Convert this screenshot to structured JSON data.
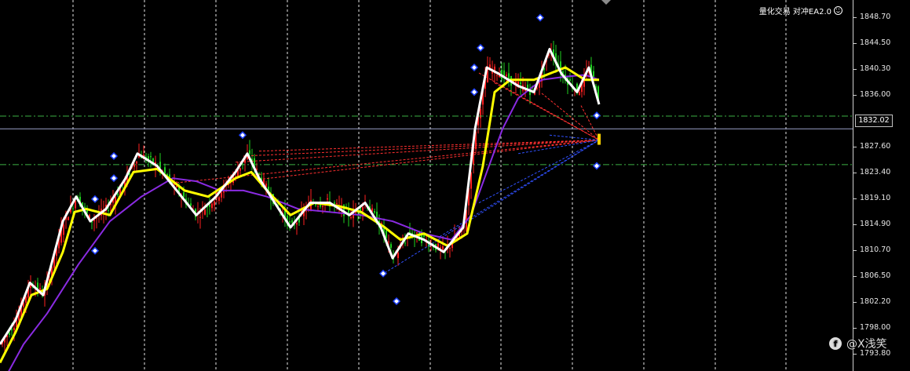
{
  "indicator": {
    "label": "量化交易 对冲EA2.0",
    "icon": "smiley-icon"
  },
  "price_axis": {
    "ticks": [
      "1848.70",
      "1844.50",
      "1840.30",
      "1836.00",
      "1827.60",
      "1823.40",
      "1819.10",
      "1814.90",
      "1810.70",
      "1806.50",
      "1802.20",
      "1798.00",
      "1793.80"
    ],
    "current_price": "1832.02"
  },
  "watermark": {
    "logo_text": "f",
    "text": "@X浅笑"
  },
  "colors": {
    "background": "#000000",
    "grid": "#ffffff",
    "bull_candle": "#ff2020",
    "bear_candle": "#20d020",
    "ma_fast": "#ffffff",
    "ma_mid": "#ffff00",
    "ma_slow": "#8a2be2",
    "level_line": "#3cb043",
    "price_line": "#9aa0c8",
    "projection_red": "#ff3030",
    "projection_blue": "#3050ff",
    "signal_marker": "#1e40ff"
  },
  "chart_data": {
    "type": "candlestick",
    "symbol_hint": "XAUUSD",
    "ylim": [
      1793.8,
      1850.5
    ],
    "level_lines": [
      1834.1,
      1826.2
    ],
    "current_price": 1832.02,
    "anchor": {
      "x": 763,
      "price": 1830.2
    },
    "close_path": [
      [
        0,
        1797
      ],
      [
        20,
        1801
      ],
      [
        40,
        1806.5
      ],
      [
        60,
        1805.5
      ],
      [
        80,
        1816
      ],
      [
        95,
        1820
      ],
      [
        110,
        1818
      ],
      [
        135,
        1819
      ],
      [
        165,
        1826
      ],
      [
        200,
        1825
      ],
      [
        230,
        1823
      ],
      [
        260,
        1820
      ],
      [
        290,
        1822
      ],
      [
        310,
        1827
      ],
      [
        335,
        1823
      ],
      [
        360,
        1816
      ],
      [
        390,
        1820
      ],
      [
        420,
        1820
      ],
      [
        450,
        1818
      ],
      [
        470,
        1819
      ],
      [
        495,
        1813
      ],
      [
        520,
        1816
      ],
      [
        545,
        1813
      ],
      [
        575,
        1812.5
      ],
      [
        595,
        1818
      ],
      [
        615,
        1838
      ],
      [
        630,
        1841
      ],
      [
        660,
        1840
      ],
      [
        690,
        1842
      ],
      [
        710,
        1844
      ],
      [
        730,
        1840
      ],
      [
        750,
        1841
      ],
      [
        763,
        1838
      ]
    ],
    "ma_fast": [
      [
        0,
        1797
      ],
      [
        20,
        1801
      ],
      [
        40,
        1806.5
      ],
      [
        60,
        1805.5
      ],
      [
        80,
        1816
      ],
      [
        95,
        1820
      ],
      [
        110,
        1818
      ],
      [
        135,
        1819
      ],
      [
        165,
        1826
      ],
      [
        200,
        1825
      ],
      [
        230,
        1823
      ],
      [
        260,
        1820
      ],
      [
        290,
        1822
      ],
      [
        310,
        1827
      ],
      [
        335,
        1823
      ],
      [
        360,
        1816
      ],
      [
        390,
        1820
      ],
      [
        420,
        1820
      ],
      [
        450,
        1818
      ],
      [
        470,
        1819
      ],
      [
        495,
        1813
      ],
      [
        520,
        1816
      ],
      [
        545,
        1813
      ],
      [
        575,
        1812.5
      ],
      [
        595,
        1818
      ],
      [
        615,
        1838
      ],
      [
        630,
        1841
      ],
      [
        660,
        1840
      ],
      [
        690,
        1842
      ],
      [
        710,
        1844
      ],
      [
        730,
        1840
      ],
      [
        750,
        1841
      ],
      [
        763,
        1838
      ]
    ],
    "ma_mid": [
      [
        0,
        1794
      ],
      [
        20,
        1799
      ],
      [
        40,
        1805
      ],
      [
        60,
        1806
      ],
      [
        80,
        1812
      ],
      [
        95,
        1818.5
      ],
      [
        110,
        1819
      ],
      [
        140,
        1818
      ],
      [
        170,
        1825
      ],
      [
        200,
        1825.5
      ],
      [
        235,
        1822
      ],
      [
        265,
        1821
      ],
      [
        300,
        1824
      ],
      [
        320,
        1825
      ],
      [
        340,
        1822
      ],
      [
        370,
        1818
      ],
      [
        400,
        1820
      ],
      [
        430,
        1819.5
      ],
      [
        460,
        1818.5
      ],
      [
        490,
        1816
      ],
      [
        510,
        1814
      ],
      [
        540,
        1815
      ],
      [
        570,
        1813
      ],
      [
        595,
        1815
      ],
      [
        615,
        1826
      ],
      [
        630,
        1838
      ],
      [
        650,
        1840
      ],
      [
        680,
        1840
      ],
      [
        700,
        1841
      ],
      [
        720,
        1842
      ],
      [
        745,
        1840
      ],
      [
        763,
        1840
      ]
    ],
    "ma_slow": [
      [
        0,
        1790
      ],
      [
        30,
        1797
      ],
      [
        60,
        1802
      ],
      [
        100,
        1810
      ],
      [
        140,
        1817
      ],
      [
        180,
        1821
      ],
      [
        220,
        1824
      ],
      [
        250,
        1823.5
      ],
      [
        280,
        1822
      ],
      [
        310,
        1822
      ],
      [
        340,
        1821
      ],
      [
        380,
        1819
      ],
      [
        420,
        1818.5
      ],
      [
        460,
        1818
      ],
      [
        500,
        1817
      ],
      [
        540,
        1815
      ],
      [
        575,
        1814
      ],
      [
        600,
        1818
      ],
      [
        620,
        1825
      ],
      [
        640,
        1832
      ],
      [
        660,
        1837
      ],
      [
        690,
        1840
      ],
      [
        720,
        1840.5
      ],
      [
        745,
        1840.8
      ],
      [
        763,
        1840
      ]
    ],
    "ma_fast_pts": [
      [
        0,
        1797
      ],
      [
        20,
        1801
      ],
      [
        38,
        1807
      ],
      [
        55,
        1805
      ],
      [
        80,
        1817
      ],
      [
        97,
        1821
      ],
      [
        115,
        1817
      ],
      [
        135,
        1819
      ],
      [
        160,
        1824
      ],
      [
        175,
        1828
      ],
      [
        200,
        1826
      ],
      [
        225,
        1822
      ],
      [
        250,
        1818
      ],
      [
        275,
        1821
      ],
      [
        300,
        1825
      ],
      [
        315,
        1828
      ],
      [
        330,
        1824
      ],
      [
        350,
        1820
      ],
      [
        370,
        1816
      ],
      [
        395,
        1820
      ],
      [
        420,
        1820
      ],
      [
        445,
        1818
      ],
      [
        465,
        1820
      ],
      [
        485,
        1816
      ],
      [
        500,
        1811
      ],
      [
        520,
        1815
      ],
      [
        540,
        1814
      ],
      [
        565,
        1812
      ],
      [
        590,
        1816
      ],
      [
        605,
        1832
      ],
      [
        620,
        1842
      ],
      [
        635,
        1841
      ],
      [
        660,
        1839
      ],
      [
        680,
        1838
      ],
      [
        700,
        1845
      ],
      [
        715,
        1841
      ],
      [
        735,
        1838
      ],
      [
        750,
        1842
      ],
      [
        763,
        1836
      ]
    ],
    "signal_markers": [
      [
        688,
        1850.1
      ],
      [
        612,
        1845.2
      ],
      [
        604,
        1842.0
      ],
      [
        604,
        1838.0
      ],
      [
        309,
        1831.0
      ],
      [
        145,
        1827.6
      ],
      [
        145,
        1824.0
      ],
      [
        121,
        1820.6
      ],
      [
        121,
        1812.2
      ],
      [
        760,
        1834.2
      ],
      [
        760,
        1826.0
      ],
      [
        488,
        1808.5
      ],
      [
        505,
        1804.0
      ]
    ],
    "red_projection_sources": [
      [
        310,
        1827.6
      ],
      [
        330,
        1828.4
      ],
      [
        300,
        1826.6
      ],
      [
        330,
        1823.8
      ],
      [
        220,
        1823.2
      ],
      [
        610,
        1841.1
      ],
      [
        630,
        1839.5
      ],
      [
        645,
        1838.6
      ],
      [
        690,
        1837.8
      ],
      [
        740,
        1835.8
      ]
    ],
    "blue_projection_sources": [
      [
        490,
        1808.6
      ],
      [
        560,
        1814.5
      ],
      [
        610,
        1820.0
      ],
      [
        660,
        1828.0
      ],
      [
        700,
        1831.0
      ]
    ]
  }
}
